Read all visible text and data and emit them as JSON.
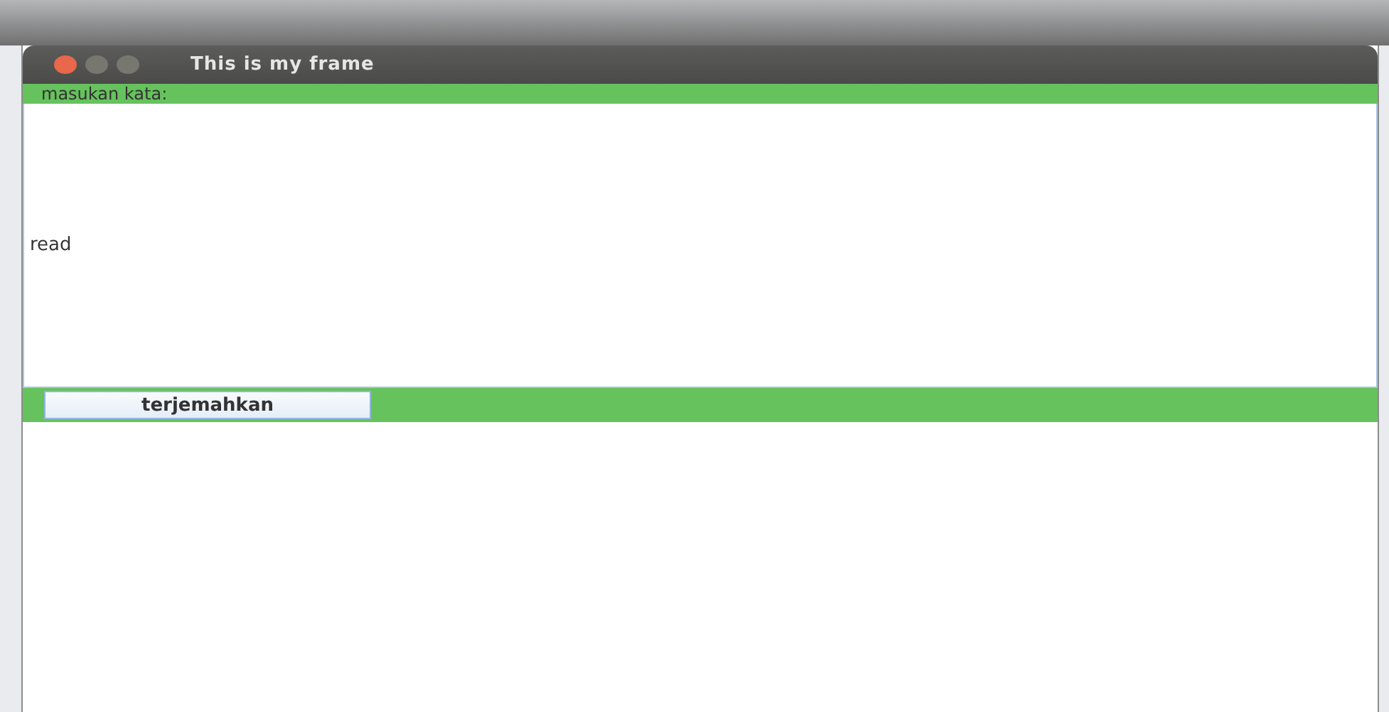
{
  "window": {
    "title": "This is my frame"
  },
  "label": "masukan kata:",
  "input": {
    "value": "read"
  },
  "button": "terjemahkan"
}
